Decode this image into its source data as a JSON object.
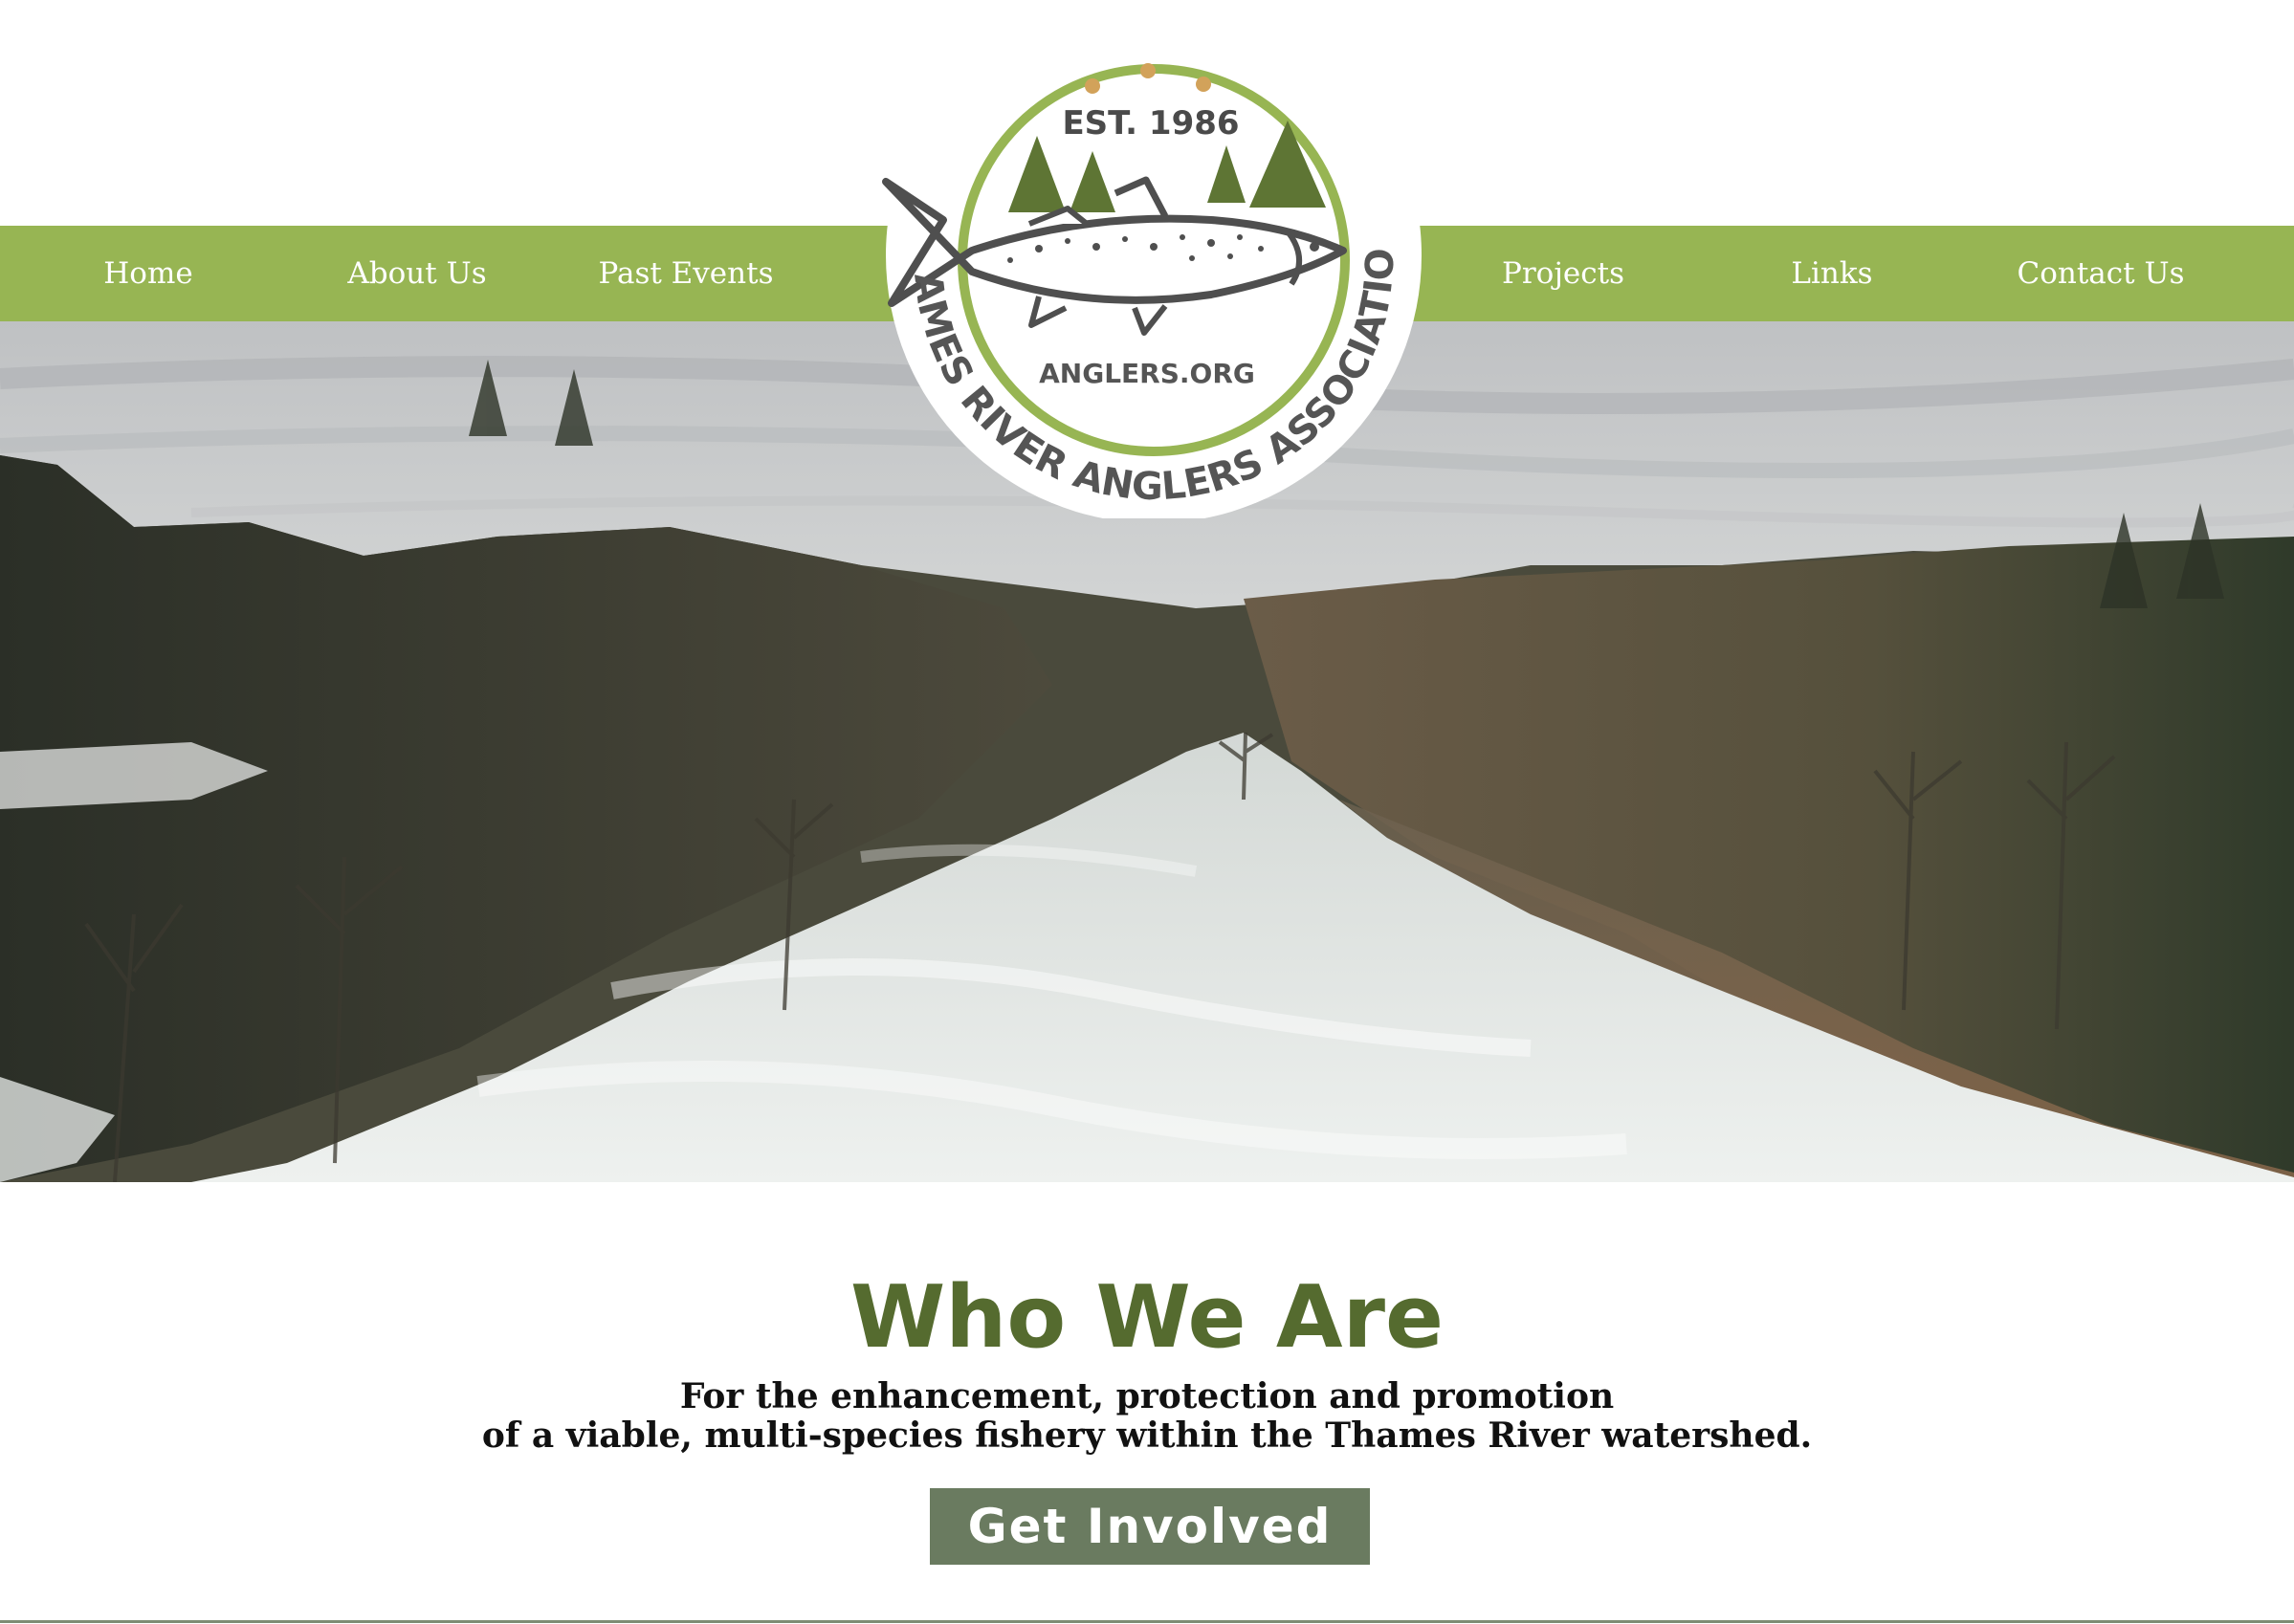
{
  "nav": {
    "left": [
      {
        "label": "Home"
      },
      {
        "label": "About Us"
      },
      {
        "label": "Past Events"
      }
    ],
    "right": [
      {
        "label": "Projects"
      },
      {
        "label": "Links"
      },
      {
        "label": "Contact Us"
      }
    ]
  },
  "logo": {
    "established": "EST. 1986",
    "site": "ANGLERS.ORG",
    "organization": "THAMES RIVER ANGLERS ASSOCIATION"
  },
  "about": {
    "title": "Who We Are",
    "mission_line1": "For the enhancement, protection and promotion",
    "mission_line2": "of a viable, multi-species fishery within the Thames River watershed.",
    "cta_label": "Get Involved"
  },
  "colors": {
    "nav_green": "#97b553",
    "title_green": "#556b2f",
    "button": "#6a7b60",
    "logo_ring": "#97b553",
    "tree_green": "#5e7534",
    "fish_outline": "#555555"
  }
}
